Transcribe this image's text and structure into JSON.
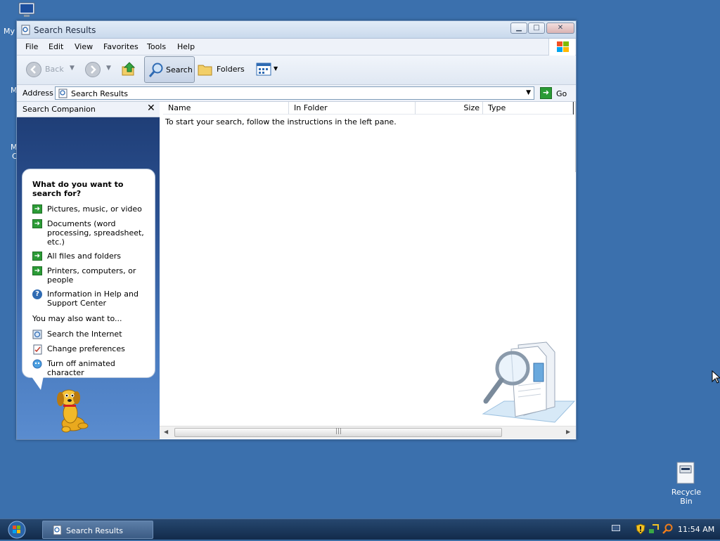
{
  "desktop": {
    "icons": [
      {
        "label": "My",
        "name": "my-computer"
      },
      {
        "label": "Recycle Bin",
        "name": "recycle-bin"
      }
    ]
  },
  "window": {
    "title": "Search Results",
    "menu": [
      "File",
      "Edit",
      "View",
      "Favorites",
      "Tools",
      "Help"
    ],
    "toolbar": {
      "back_label": "Back",
      "search_label": "Search",
      "folders_label": "Folders"
    },
    "address": {
      "label": "Address",
      "value": "Search Results",
      "go_label": "Go"
    },
    "search_companion": {
      "header": "Search Companion",
      "question": "What do you want to search for?",
      "options": [
        {
          "label": "Pictures, music, or video",
          "icon": "green-arrow-icon"
        },
        {
          "label": "Documents (word processing, spreadsheet, etc.)",
          "icon": "green-arrow-icon"
        },
        {
          "label": "All files and folders",
          "icon": "green-arrow-icon"
        },
        {
          "label": "Printers, computers, or people",
          "icon": "green-arrow-icon"
        },
        {
          "label": "Information in Help and Support Center",
          "icon": "help-icon"
        }
      ],
      "also_label": "You may also want to...",
      "also_options": [
        {
          "label": "Search the Internet",
          "icon": "search-internet-icon"
        },
        {
          "label": "Change preferences",
          "icon": "preferences-icon"
        },
        {
          "label": "Turn off animated character",
          "icon": "character-icon"
        }
      ]
    },
    "columns": [
      "Name",
      "In Folder",
      "Size",
      "Type"
    ],
    "instructions": "To start your search, follow the instructions in the left pane."
  },
  "taskbar": {
    "task_label": "Search Results",
    "clock": "11:54 AM"
  }
}
